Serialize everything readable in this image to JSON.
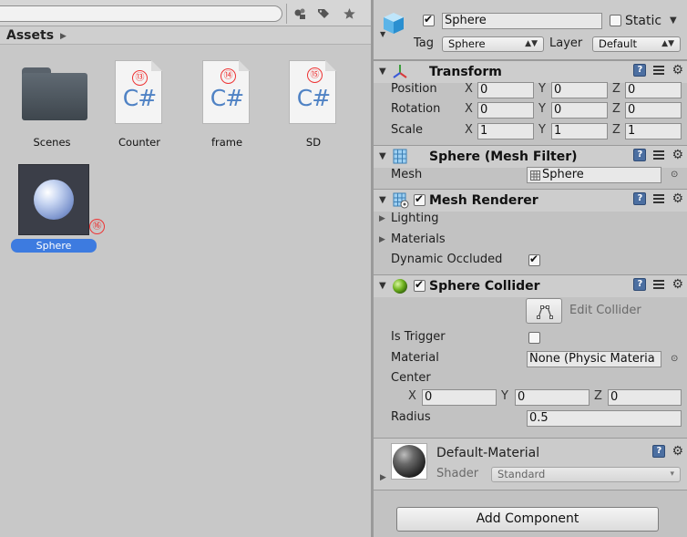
{
  "project": {
    "breadcrumb": "Assets",
    "assets": [
      {
        "name": "Scenes",
        "kind": "folder"
      },
      {
        "name": "Counter",
        "kind": "script",
        "badge": "⑬",
        "glyph": "C#"
      },
      {
        "name": "frame",
        "kind": "script",
        "badge": "⑭",
        "glyph": "C#"
      },
      {
        "name": "SD",
        "kind": "script",
        "badge": "⑮",
        "glyph": "C#"
      },
      {
        "name": "Sphere",
        "kind": "mesh",
        "badge": "⑯",
        "selected": true
      }
    ]
  },
  "inspector": {
    "object_name": "Sphere",
    "active": true,
    "static_label": "Static",
    "static_checked": false,
    "tag_label": "Tag",
    "tag_value": "Sphere",
    "layer_label": "Layer",
    "layer_value": "Default",
    "transform": {
      "title": "Transform",
      "rows": [
        {
          "label": "Position",
          "x": "0",
          "y": "0",
          "z": "0"
        },
        {
          "label": "Rotation",
          "x": "0",
          "y": "0",
          "z": "0"
        },
        {
          "label": "Scale",
          "x": "1",
          "y": "1",
          "z": "1"
        }
      ]
    },
    "mesh_filter": {
      "title": "Sphere (Mesh Filter)",
      "mesh_label": "Mesh",
      "mesh_value": "Sphere"
    },
    "mesh_renderer": {
      "title": "Mesh Renderer",
      "enabled": true,
      "lighting_label": "Lighting",
      "materials_label": "Materials",
      "dynamic_occluded_label": "Dynamic Occluded",
      "dynamic_occluded": true
    },
    "sphere_collider": {
      "title": "Sphere Collider",
      "enabled": true,
      "edit_collider_label": "Edit Collider",
      "is_trigger_label": "Is Trigger",
      "is_trigger": false,
      "material_label": "Material",
      "material_value": "None (Physic Materia",
      "center_label": "Center",
      "center": {
        "x": "0",
        "y": "0",
        "z": "0"
      },
      "radius_label": "Radius",
      "radius_value": "0.5"
    },
    "material": {
      "name": "Default-Material",
      "shader_label": "Shader",
      "shader_value": "Standard"
    },
    "add_component_label": "Add Component",
    "axis_labels": {
      "x": "X",
      "y": "Y",
      "z": "Z"
    }
  },
  "colors": {
    "selection": "#3d7be0",
    "script_glyph": "#4f82c4",
    "badge": "#e22222"
  }
}
